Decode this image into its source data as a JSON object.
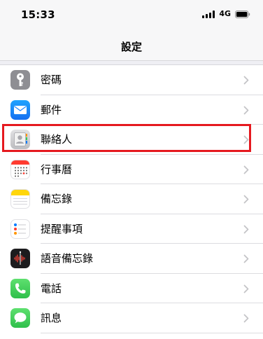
{
  "status_bar": {
    "time": "15:33",
    "network": "4G"
  },
  "nav": {
    "title": "設定"
  },
  "settings": {
    "items": [
      {
        "label": "密碼",
        "icon": "key-icon",
        "color": "#8e8e93"
      },
      {
        "label": "郵件",
        "icon": "mail-icon",
        "color": "#1a82fb"
      },
      {
        "label": "聯絡人",
        "icon": "contacts-icon",
        "color": "#c8c8cc"
      },
      {
        "label": "行事曆",
        "icon": "calendar-icon",
        "color": "#ffffff"
      },
      {
        "label": "備忘錄",
        "icon": "notes-icon",
        "color": "#ffd60a"
      },
      {
        "label": "提醒事項",
        "icon": "reminders-icon",
        "color": "#ffffff"
      },
      {
        "label": "語音備忘錄",
        "icon": "voice-memos-icon",
        "color": "#1c1c1e"
      },
      {
        "label": "電話",
        "icon": "phone-icon",
        "color": "#34c759"
      },
      {
        "label": "訊息",
        "icon": "messages-icon",
        "color": "#34c759"
      }
    ]
  },
  "highlight": {
    "target": "聯絡人",
    "color": "#e5191f"
  }
}
